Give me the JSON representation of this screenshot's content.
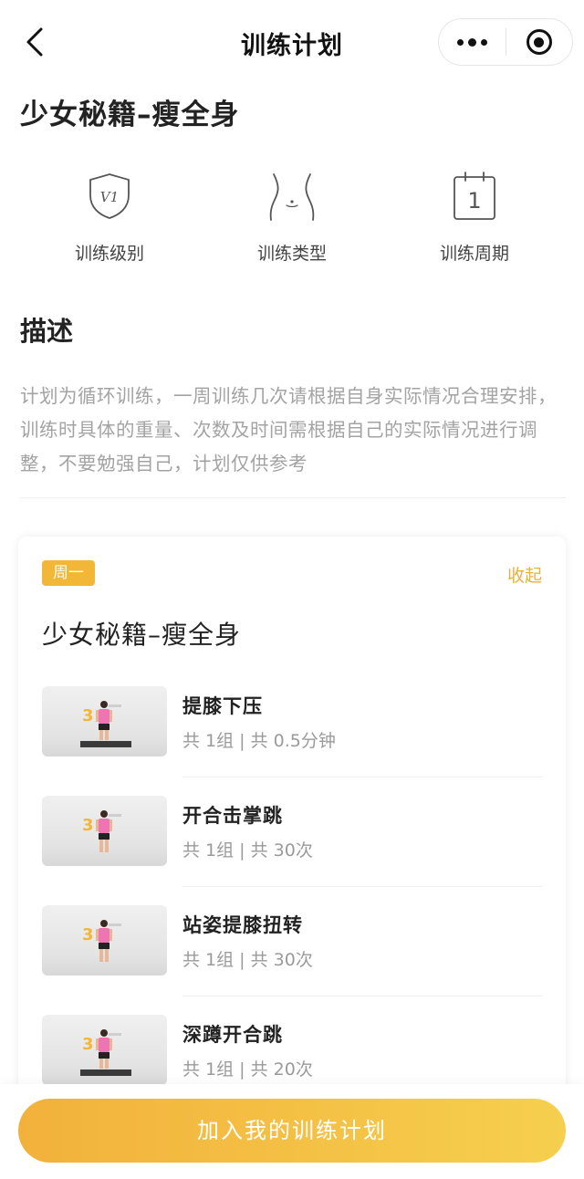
{
  "nav": {
    "title": "训练计划",
    "back_icon": "chevron-left-icon",
    "more_icon": "more-dots-icon",
    "target_icon": "target-icon"
  },
  "plan": {
    "title": "少女秘籍–瘦全身"
  },
  "info": [
    {
      "icon": "shield-level-icon",
      "icon_text": "V1",
      "label": "训练级别"
    },
    {
      "icon": "waist-icon",
      "label": "训练类型"
    },
    {
      "icon": "calendar-icon",
      "icon_text": "1",
      "label": "训练周期"
    }
  ],
  "description": {
    "heading": "描述",
    "text": "计划为循环训练，一周训练几次请根据自身实际情况合理安排，训练时具体的重量、次数及时间需根据自己的实际情况进行调整，不要勉强自己，计划仅供参考"
  },
  "day": {
    "badge": "周一",
    "collapse_label": "收起",
    "title": "少女秘籍–瘦全身",
    "exercises": [
      {
        "name": "提膝下压",
        "meta": "共 1组 | 共 0.5分钟"
      },
      {
        "name": "开合击掌跳",
        "meta": "共 1组 | 共 30次"
      },
      {
        "name": "站姿提膝扭转",
        "meta": "共 1组 | 共 30次"
      },
      {
        "name": "深蹲开合跳",
        "meta": "共 1组 | 共 20次"
      }
    ]
  },
  "bottom": {
    "join_label": "加入我的训练计划"
  },
  "colors": {
    "accent": "#f2b736",
    "button_start": "#f2b13b",
    "button_end": "#f6cf4e",
    "muted_text": "#a3a3a3"
  }
}
